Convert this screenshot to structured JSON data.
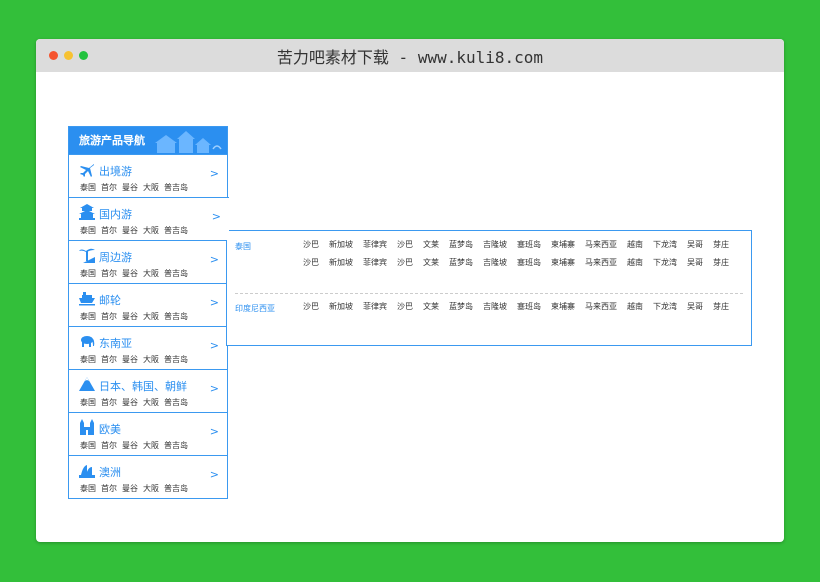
{
  "window": {
    "title": "苦力吧素材下载 - www.kuli8.com"
  },
  "nav": {
    "title": "旅游产品导航",
    "links": [
      "泰国",
      "首尔",
      "曼谷",
      "大阪",
      "普吉岛"
    ],
    "arrow": ">",
    "items": [
      {
        "label": "出境游",
        "icon": "airplane-icon"
      },
      {
        "label": "国内游",
        "icon": "pagoda-icon"
      },
      {
        "label": "周边游",
        "icon": "palm-tree-icon"
      },
      {
        "label": "邮轮",
        "icon": "cruise-ship-icon"
      },
      {
        "label": "东南亚",
        "icon": "elephant-icon"
      },
      {
        "label": "日本、韩国、朝鲜",
        "icon": "mountain-icon"
      },
      {
        "label": "欧美",
        "icon": "castle-icon"
      },
      {
        "label": "澳洲",
        "icon": "opera-house-icon"
      }
    ]
  },
  "panel": {
    "regions": [
      {
        "name": "泰国",
        "cities": [
          "沙巴",
          "新加坡",
          "菲律宾",
          "沙巴",
          "文莱",
          "蓝梦岛",
          "吉隆坡",
          "塞班岛",
          "柬埔寨",
          "马来西亚",
          "越南",
          "下龙湾",
          "吴哥",
          "芽庄",
          "沙巴",
          "新加坡",
          "菲律宾",
          "沙巴",
          "文莱",
          "蓝梦岛",
          "吉隆坡",
          "塞班岛",
          "柬埔寨",
          "马来西亚",
          "越南",
          "下龙湾",
          "吴哥",
          "芽庄"
        ]
      },
      {
        "name": "印度尼西亚",
        "cities": [
          "沙巴",
          "新加坡",
          "菲律宾",
          "沙巴",
          "文莱",
          "蓝梦岛",
          "吉隆坡",
          "塞班岛",
          "柬埔寨",
          "马来西亚",
          "越南",
          "下龙湾",
          "吴哥",
          "芽庄"
        ]
      }
    ]
  },
  "colors": {
    "accent": "#2b8ff0",
    "background": "#33bf3a",
    "titlebar": "#dcdcdc"
  }
}
